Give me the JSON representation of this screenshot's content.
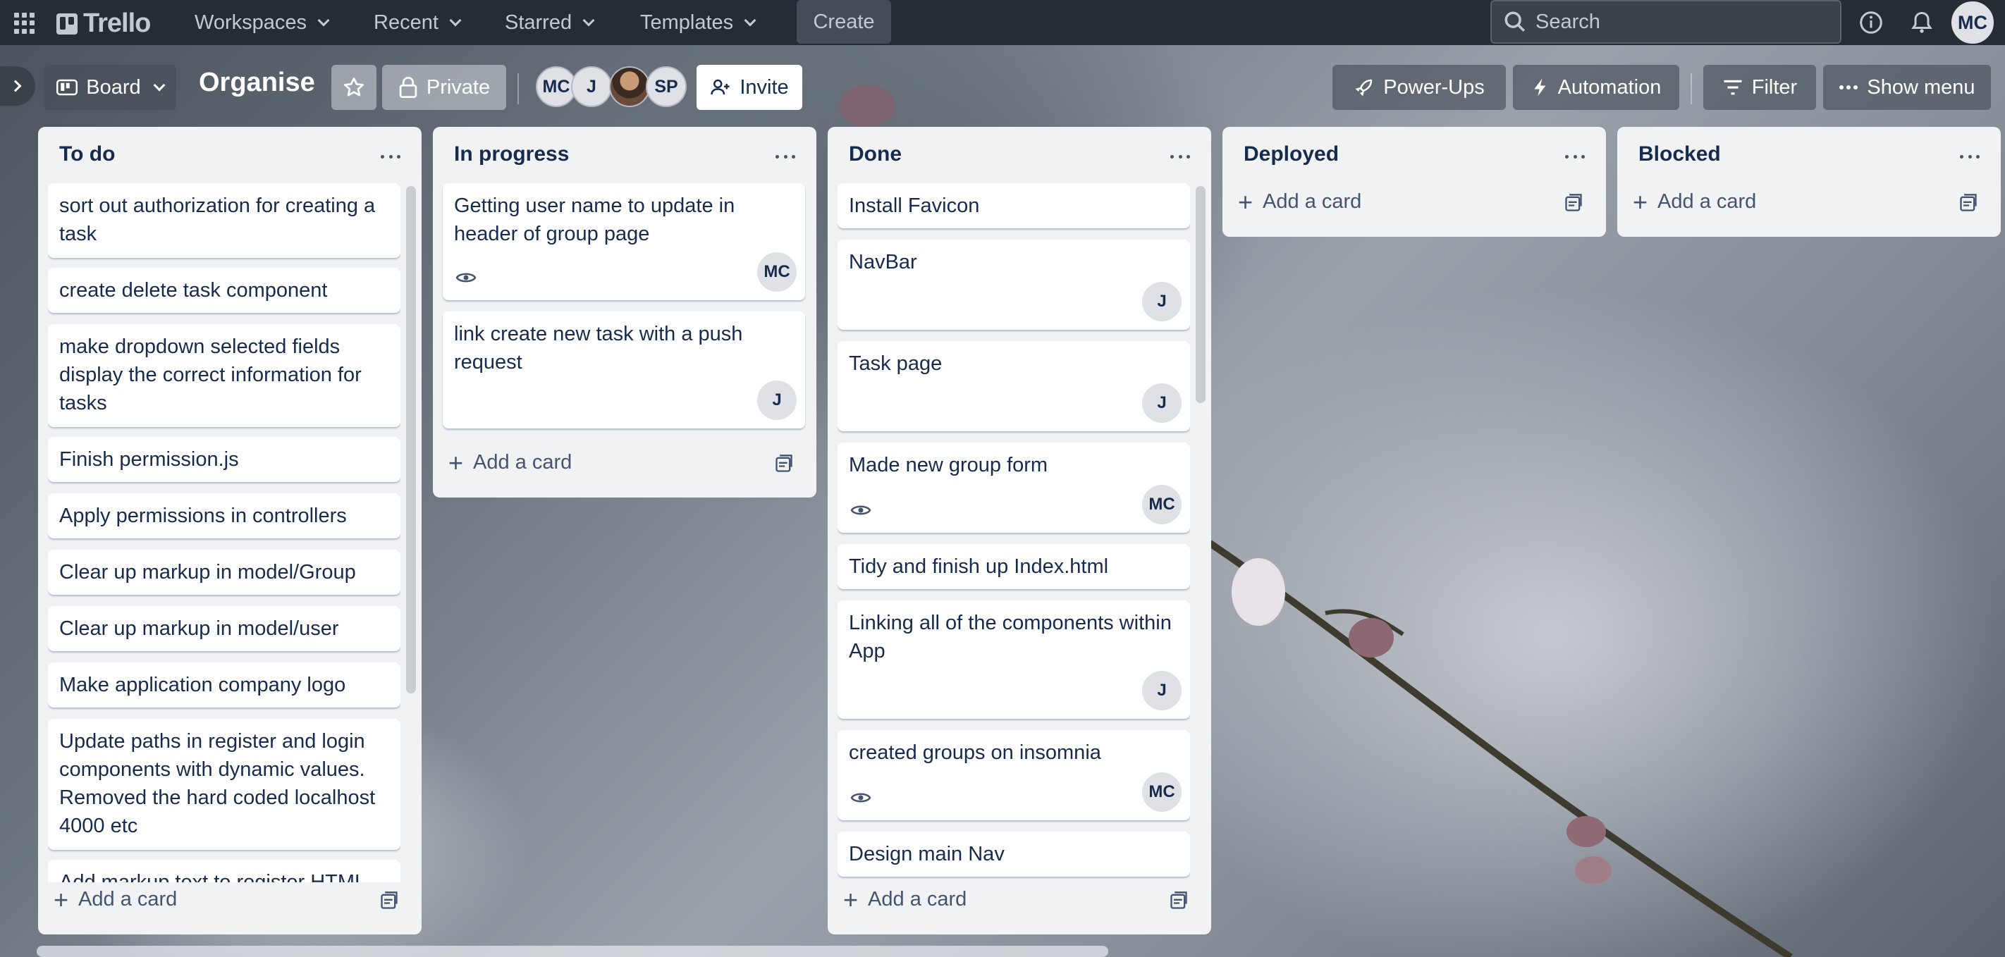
{
  "nav": {
    "logo": "Trello",
    "workspaces": "Workspaces",
    "recent": "Recent",
    "starred": "Starred",
    "templates": "Templates",
    "create": "Create",
    "search_placeholder": "Search",
    "user_initials": "MC"
  },
  "board": {
    "view_label": "Board",
    "title": "Organise",
    "visibility": "Private",
    "members": [
      "MC",
      "J",
      "",
      "SP"
    ],
    "invite": "Invite",
    "power_ups": "Power-Ups",
    "automation": "Automation",
    "filter": "Filter",
    "show_menu": "Show menu"
  },
  "lists": [
    {
      "title": "To do",
      "add_card": "Add a card",
      "cards": [
        {
          "text": "sort out authorization for creating a task"
        },
        {
          "text": "create delete task component"
        },
        {
          "text": "make dropdown selected fields display the correct information for tasks"
        },
        {
          "text": "Finish permission.js"
        },
        {
          "text": "Apply permissions in controllers"
        },
        {
          "text": "Clear up markup in model/Group"
        },
        {
          "text": "Clear up markup in model/user"
        },
        {
          "text": "Make application company logo"
        },
        {
          "text": "Update paths in register and login components with dynamic values. Removed the hard coded localhost 4000 etc"
        },
        {
          "text": "Add markup text to register HTML"
        }
      ]
    },
    {
      "title": "In progress",
      "add_card": "Add a card",
      "cards": [
        {
          "text": "Getting user name to update in header of group page",
          "member": "MC"
        },
        {
          "text": "link create new task with a push request",
          "member": "J"
        }
      ]
    },
    {
      "title": "Done",
      "add_card": "Add a card",
      "cards": [
        {
          "text": "Install Favicon"
        },
        {
          "text": "NavBar",
          "member": "J"
        },
        {
          "text": "Task page",
          "member": "J"
        },
        {
          "text": "Made new group form",
          "member": "MC"
        },
        {
          "text": "Tidy and finish up Index.html"
        },
        {
          "text": "Linking all of the components within App",
          "member": "J"
        },
        {
          "text": "created groups on insomnia",
          "member": "MC"
        },
        {
          "text": "Design main Nav"
        }
      ]
    },
    {
      "title": "Deployed",
      "add_card": "Add a card",
      "cards": []
    },
    {
      "title": "Blocked",
      "add_card": "Add a card",
      "cards": []
    }
  ],
  "colors": {
    "nav_bg": "#262c33",
    "list_bg": "#f1f2f4",
    "text": "#172b4d"
  }
}
